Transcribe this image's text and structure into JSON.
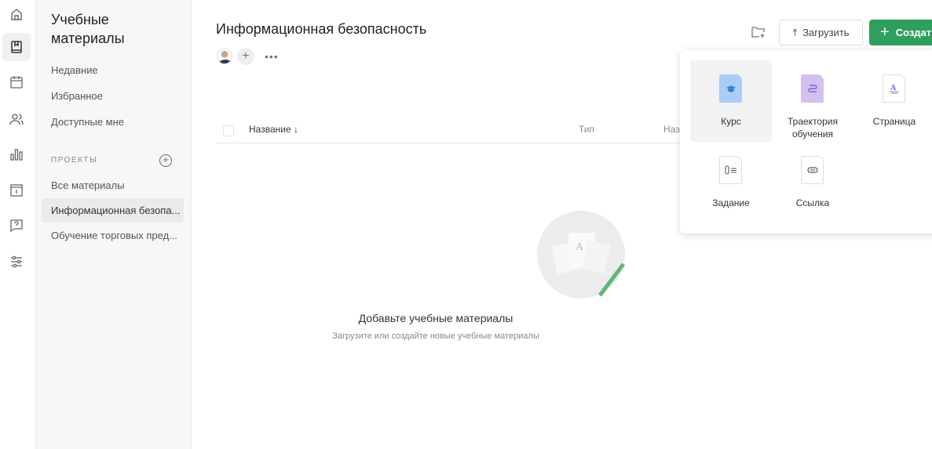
{
  "sidebar": {
    "title": "Учебные материалы",
    "items": [
      "Недавние",
      "Избранное",
      "Доступные мне"
    ],
    "projects_label": "ПРОЕКТЫ",
    "projects": [
      "Все материалы",
      "Информационная безопа...",
      "Обучение торговых пред..."
    ]
  },
  "header": {
    "title": "Информационная безопасность",
    "upload_label": "Загрузить",
    "create_label": "Создать"
  },
  "table": {
    "columns": [
      "Название",
      "Тип",
      "Назначение"
    ]
  },
  "menu": {
    "items": [
      "Курс",
      "Траектория обучения",
      "Страница",
      "Задание",
      "Ссылка"
    ]
  },
  "empty": {
    "title": "Добавьте учебные материалы",
    "subtitle": "Загрузите или создайте новые учебные материалы"
  },
  "colors": {
    "accent": "#2f9e5f",
    "course": "#a9cdf7",
    "path": "#d3c1f2"
  }
}
